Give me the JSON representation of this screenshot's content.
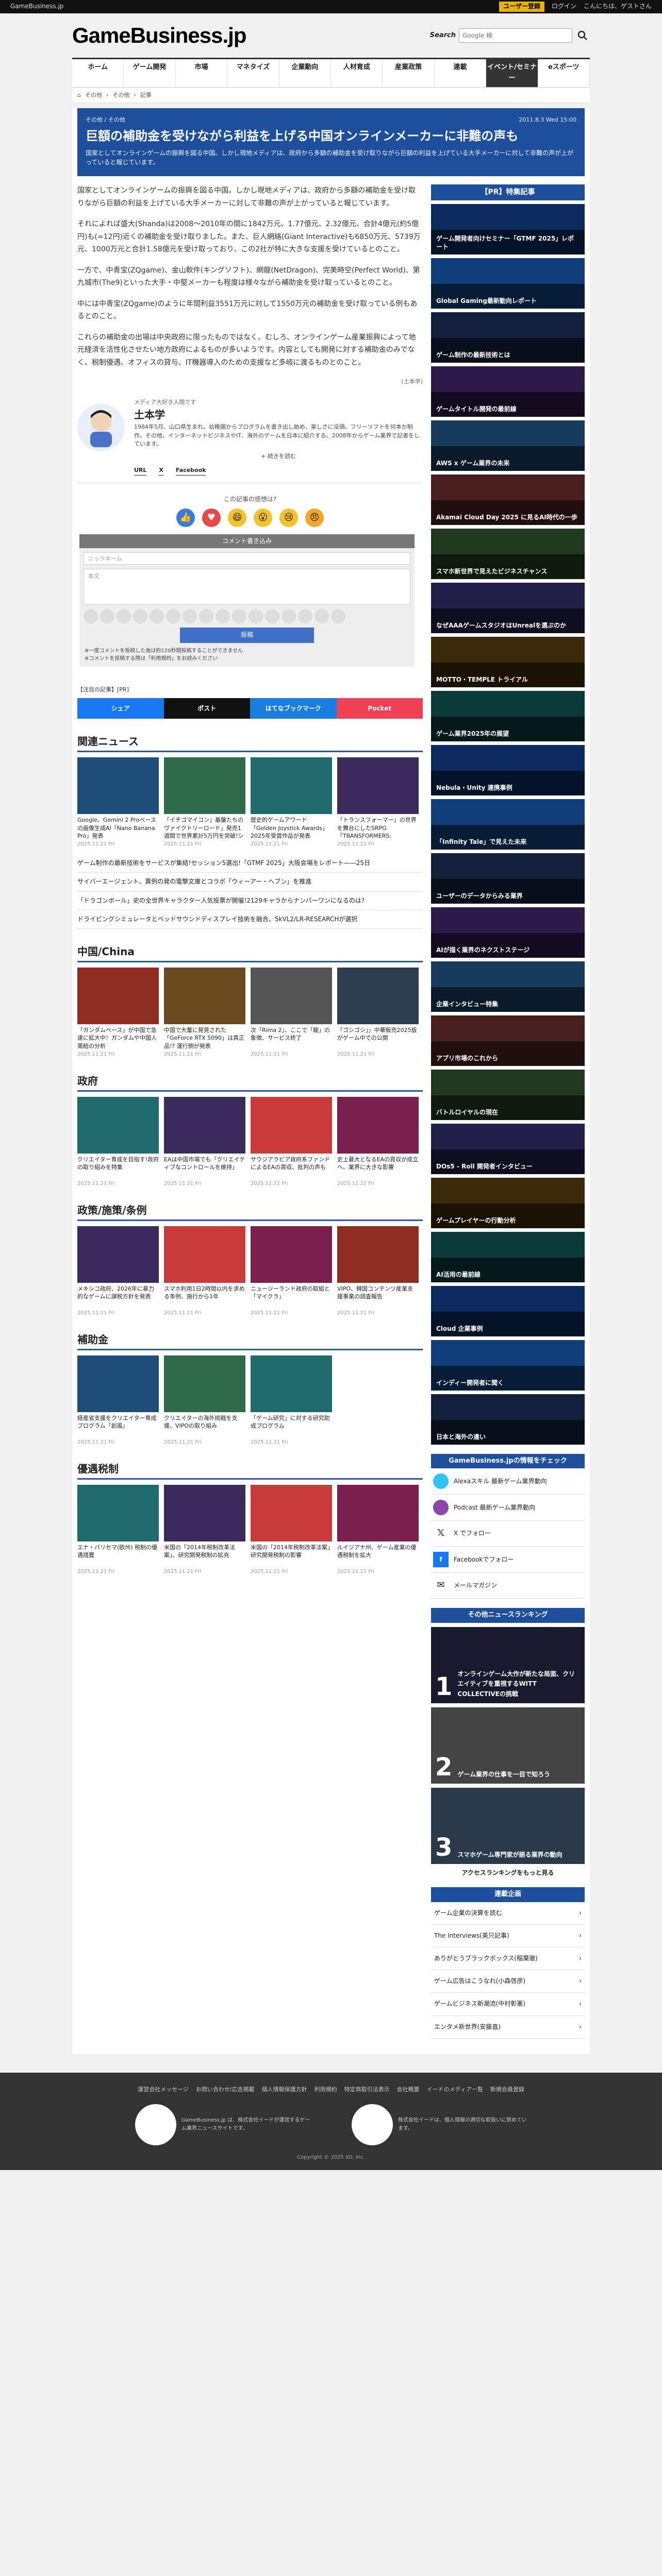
{
  "topbar": {
    "site": "GameBusiness.jp",
    "register": "ユーザー登録",
    "login": "ログイン",
    "greeting": "こんにちは、ゲストさん"
  },
  "header": {
    "logo": "GameBusiness.jp",
    "search_label": "Search",
    "search_placeholder": "Google 検"
  },
  "nav": [
    "ホーム",
    "ゲーム開発",
    "市場",
    "マネタイズ",
    "企業動向",
    "人材育成",
    "産業政策",
    "連載",
    "イベント/セミナー",
    "eスポーツ"
  ],
  "nav_active_index": 8,
  "breadcrumb": [
    "その他",
    "その他",
    "記事"
  ],
  "article": {
    "category1": "その他",
    "category2": "その他",
    "date": "2011.8.3 Wed 15:00",
    "title": "巨額の補助金を受けながら利益を上げる中国オンラインメーカーに非難の声も",
    "lead": "国家としてオンラインゲームの振興を図る中国。しかし現地メディアは、政府から多額の補助金を受け取りながら巨額の利益を上げている大手メーカーに対して非難の声が上がっていると報じています。",
    "paragraphs": [
      "国家としてオンラインゲームの振興を図る中国。しかし現地メディアは、政府から多額の補助金を受け取りながら巨額の利益を上げている大手メーカーに対して非難の声が上がっていると報じています。",
      "それによれば盛大(Shanda)は2008〜2010年の間に1842万元、1.77億元、2.32億元、合計4億元(約5億円)も(=12円)近くの補助金を受け取りました。また、巨人網絡(Giant Interactive)も6850万元、5739万元、1000万元と合計1.58億元を受け取っており、この2社が特に大きな支援を受けているとのこと。",
      "一方で、中青宝(ZQgame)、金山軟件(キングソフト)、網龍(NetDragon)、完美時空(Perfect World)、第九城市(The9)といった大手・中堅メーカーも程度は様々ながら補助金を受け取っているとのこと。",
      "中には中青宝(ZQgame)のように年間利益3551万元に対して1550万元の補助金を受け取っている例もあるとのこと。",
      "これらの補助金の出場は中央政府に限ったものではなく、むしろ、オンラインゲーム産業振興によって地元経済を活性化させたい地方政府によるものが多いようです。内容としても開発に対する補助金のみでなく、税制優遇、オフィスの貸与、IT機器導入のための支援など多岐に渡るものとのこと。"
    ],
    "credit": "(土本学)"
  },
  "author": {
    "role": "メディア大好き人間です",
    "name": "土本学",
    "bio": "1984年5月、山口県生まれ。幼稚園からプログラムを書き出し始め、楽しさに没頭。フリーソフトを何本か制作。その他、インターネットビジネスやIT、海外のゲームを日本に紹介する。2008年からゲーム業界で記者をしています。",
    "more": "続きを読む",
    "links": [
      "URL",
      "X",
      "Facebook"
    ]
  },
  "reaction": {
    "title": "この記事の感想は?"
  },
  "comment": {
    "header": "コメント書き込み",
    "name_placeholder": "ニックネーム",
    "body_placeholder": "本文",
    "submit": "投稿",
    "note1": "※一度コメントを投稿した後は約120秒間投稿することができません",
    "note2": "※コメントを投稿する際は「利用規約」をお読みください"
  },
  "pr_label": "【注目の記事】[PR]",
  "share": [
    "シェア",
    "ポスト",
    "はてなブックマーク",
    "Pocket"
  ],
  "related": {
    "title": "関連ニュース",
    "cards": [
      {
        "text": "Google、Gemini 2 Proベースの画像生成AI「Nano Banana Pro」発表",
        "date": "2025.11.21 Fri"
      },
      {
        "text": "「イチゴマイコン」基盤たちのヴァイクトリーロード」発売1週間で世界累計5万円を突破!シリーズ最新作が好調を博す",
        "date": "2025.11.21 Fri"
      },
      {
        "text": "歴史的ゲームアワード「Golden Joystick Awards」2025年受賞作品が発表",
        "date": "2025.11.21 Fri"
      },
      {
        "text": "「トランスフォーマー」の世界を舞台にしたSRPG「TRANSFORMERS: REACTIVATE」",
        "date": "2025.11.21 Fri"
      }
    ],
    "list": [
      "ゲーム制作の最新技術をサービスが集結!セッション5選出!「GTMF 2025」大阪会場をレポート——25日",
      "サイバーエージェント、異例の発の電撃文庫とコラボ「ウィーアー・ヘブン」を推進",
      "「ドラゴンボール」史の全世界キャラクター人気投票が開催!2129キャラからナンバーワンになるのは?",
      "ドライビングシミュレータとベッドサウンドディスプレイ技術を融合、5kVL2/LR-RESEARCHが選択"
    ]
  },
  "china": {
    "title": "中国/China",
    "cards": [
      {
        "text": "「ガンダムベース」が中国で急速に拡大中！ガンダムや中国人需給の分析",
        "date": "2025.11.21 Fri"
      },
      {
        "text": "中国で大量に発見された「GeForce RTX 5090」は真正品!? 運行側が発表",
        "date": "2025.11.21 Fri"
      },
      {
        "text": "次「Rima 2」、ここで「龍」の象徴、サービス終了",
        "date": "2025.11.21 Fri"
      },
      {
        "text": "「ゴシゴシ」」中華販売2025版がゲーム中での公開",
        "date": "2025.11.21 Fri"
      }
    ]
  },
  "gov": {
    "title": "政府",
    "cards": [
      {
        "text": "クリエイター育成を目指す!政府の取り組みを特集",
        "date": "2025.11.21 Fri"
      },
      {
        "text": "EAは中国市場でも「クリエイティブなコントロールを維持」",
        "date": "2025.11.21 Fri"
      },
      {
        "text": "サウジアラビア政府系ファンドによるEAの買収、批判の声も",
        "date": "2025.11.21 Fri"
      },
      {
        "text": "史上最大となるEAの買収が成立へ、業界に大きな影響",
        "date": "2025.11.21 Fri"
      }
    ]
  },
  "policy": {
    "title": "政策/施策/条例",
    "cards": [
      {
        "text": "メキシコ政府、2026年に暴力的なゲームに課税方針を発表",
        "date": "2025.11.21 Fri"
      },
      {
        "text": "スマホ利用1日2時間以内を求める条例、施行から1年",
        "date": "2025.11.21 Fri"
      },
      {
        "text": "ニュージーランド政府の取組と「マイクラ」",
        "date": "2025.11.21 Fri"
      },
      {
        "text": "VIPO、韓国コンテンツ産業支援事業の調査報告",
        "date": "2025.11.21 Fri"
      }
    ]
  },
  "subsidy": {
    "title": "補助金",
    "cards": [
      {
        "text": "経産省支援をクリエイター育成プログラム「創風」",
        "date": "2025.11.21 Fri"
      },
      {
        "text": "クリエイターの海外挑戦を支援、VIPOの取り組み",
        "date": "2025.11.21 Fri"
      },
      {
        "text": "「ゲーム研究」に対する研究助成プログラム",
        "date": "2025.11.21 Fri"
      }
    ]
  },
  "tax": {
    "title": "優遇税制",
    "cards": [
      {
        "text": "エナ・パリセマ(欧州) 税制の優遇措置",
        "date": "2025.11.21 Fri"
      },
      {
        "text": "米国の「2014年税制改革法案」、研究開発税制の拡充",
        "date": "2025.11.21 Fri"
      },
      {
        "text": "米国の「2014年税制改革法案」研究開発税制の影響",
        "date": "2025.11.21 Fri"
      },
      {
        "text": "ルイジアナ州、ゲーム産業の優遇税制を拡大",
        "date": "2025.11.21 Fri"
      }
    ]
  },
  "sidebar": {
    "pr_title": "【PR】特集記事",
    "pr_cards": [
      "ゲーム開発者向けセミナー「GTMF 2025」レポート",
      "Global Gaming最新動向レポート",
      "ゲーム制作の最新技術とは",
      "ゲームタイトル開発の最前線",
      "AWS x ゲーム業界の未来",
      "Akamai Cloud Day 2025 に見るAI時代の一歩",
      "スマホ新世界で見えたビジネスチャンス",
      "なぜAAAゲームスタジオはUnrealを選ぶのか",
      "MOTTO・TEMPLE トライアル",
      "ゲーム業界2025年の展望",
      "Nebula・Unity 連携事例",
      "「Infinity Tale」で見えた未来",
      "ユーザーのデータからみる業界",
      "AIが描く業界のネクストステージ",
      "企業インタビュー特集",
      "アプリ市場のこれから",
      "バトルロイヤルの現在",
      "DOs5 - Roll 開発者インタビュー",
      "ゲームプレイヤーの行動分析",
      "AI活用の最前線",
      "Cloud 企業事例",
      "インディー開発者に聞く",
      "日本と海外の違い"
    ],
    "check_title": "GameBusiness.jpの情報をチェック",
    "check": [
      "Alexaスキル 最新ゲーム業界動向",
      "Podcast 最新ゲーム業界動向",
      "X でフォロー",
      "Facebookでフォロー",
      "メールマガジン"
    ],
    "rank_title": "その他ニュースランキング",
    "rank": [
      {
        "num": "1",
        "text": "オンラインゲーム大作が新たな局面、クリエイティブを重視するWITT COLLECTIVEの挑戦"
      },
      {
        "num": "2",
        "text": "ゲーム業界の仕事を一目で知ろう"
      },
      {
        "num": "3",
        "text": "スマホゲーム専門家が語る業界の動向"
      }
    ],
    "rank_more": "アクセスランキングをもっと見る",
    "serial_title": "連載企画",
    "serial": [
      "ゲーム企業の決算を読む",
      "The Interviews(英只記事)",
      "ありがとうブラックボックス(稲葉徹)",
      "ゲーム広告はこうなれ(小森啓彦)",
      "ゲームビジネス新潮流(中村彰憲)",
      "エンタメ新世界(安藤直)"
    ]
  },
  "footer": {
    "links": [
      "運営会社メッセージ",
      "お問い合わせ/広告掲載",
      "個人情報保護方針",
      "利用規約",
      "特定商取引法表示",
      "会社概要",
      "イードのメディア一覧",
      "新規会員登録"
    ],
    "badge1": "GameBusiness.jp は、株式会社イードが運営するゲーム業界ニュースサイトです。",
    "badge2": "株式会社イードは、個人情報の適切な取扱いに努めています。",
    "copyright": "Copyright © 2025 IID, Inc."
  },
  "colors": {
    "brand_blue": "#1e4f9c",
    "nav_dark": "#333333"
  }
}
